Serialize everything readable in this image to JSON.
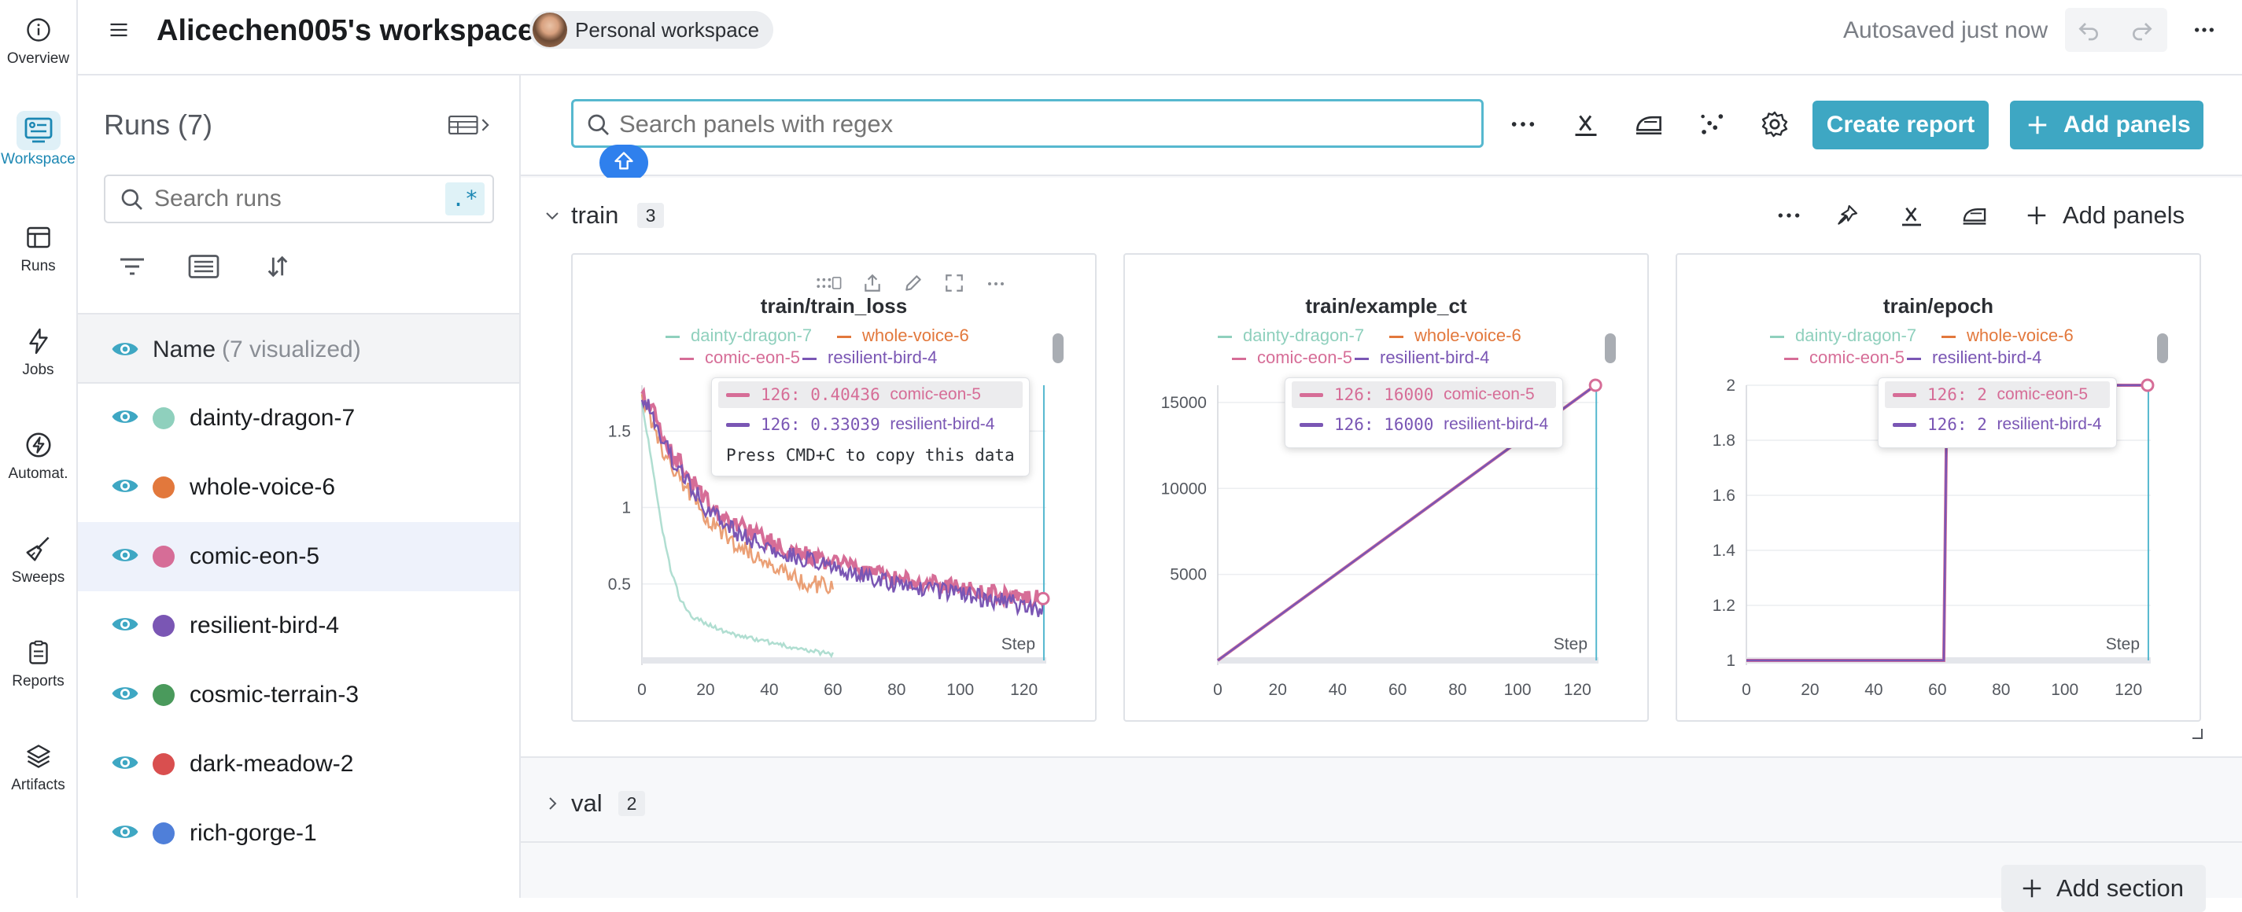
{
  "nav": {
    "items": [
      {
        "label": "Overview",
        "icon": "info-icon"
      },
      {
        "label": "Workspace",
        "icon": "workspace-icon"
      },
      {
        "label": "Runs",
        "icon": "table-icon"
      },
      {
        "label": "Jobs",
        "icon": "lightning-icon"
      },
      {
        "label": "Automat.",
        "icon": "automation-icon"
      },
      {
        "label": "Sweeps",
        "icon": "broom-icon"
      },
      {
        "label": "Reports",
        "icon": "clipboard-icon"
      },
      {
        "label": "Artifacts",
        "icon": "layers-icon"
      }
    ]
  },
  "header": {
    "title": "Alicechen005's workspace",
    "workspace_badge": "Personal workspace",
    "autosave": "Autosaved just now"
  },
  "runs": {
    "title": "Runs (7)",
    "search_placeholder": "Search runs",
    "regex_label": ".*",
    "name_col": "Name",
    "visualized": "(7 visualized)",
    "items": [
      {
        "name": "dainty-dragon-7",
        "color": "#8fd0bd"
      },
      {
        "name": "whole-voice-6",
        "color": "#e2783c"
      },
      {
        "name": "comic-eon-5",
        "color": "#d66d97"
      },
      {
        "name": "resilient-bird-4",
        "color": "#7a56b4"
      },
      {
        "name": "cosmic-terrain-3",
        "color": "#4a9a5c"
      },
      {
        "name": "dark-meadow-2",
        "color": "#d94f4f"
      },
      {
        "name": "rich-gorge-1",
        "color": "#4f7fd9"
      }
    ]
  },
  "toolbar": {
    "search_placeholder": "Search panels with regex",
    "create_report": "Create report",
    "add_panels": "Add panels"
  },
  "sections": {
    "train": {
      "name": "train",
      "count": "3",
      "add_panels": "Add panels"
    },
    "val": {
      "name": "val",
      "count": "2"
    },
    "add_section": "Add section"
  },
  "legend": {
    "dainty": "dainty-dragon-7",
    "whole": "whole-voice-6",
    "comic": "comic-eon-5",
    "resilient": "resilient-bird-4"
  },
  "colors": {
    "dainty": "#8fd0bd",
    "whole": "#e2783c",
    "comic": "#d66d97",
    "resilient": "#7a56b4",
    "accent": "#3ea7c3"
  },
  "panels": [
    {
      "title": "train/train_loss",
      "step_label": "Step",
      "tooltip": {
        "rows": [
          {
            "text": "126:  0.40436",
            "run": "comic-eon-5"
          },
          {
            "text": "126:  0.33039",
            "run": "resilient-bird-4"
          }
        ],
        "hint": "Press CMD+C to copy this data"
      }
    },
    {
      "title": "train/example_ct",
      "step_label": "Step",
      "tooltip": {
        "rows": [
          {
            "text": "126:  16000",
            "run": "comic-eon-5"
          },
          {
            "text": "126:  16000",
            "run": "resilient-bird-4"
          }
        ]
      }
    },
    {
      "title": "train/epoch",
      "step_label": "Step",
      "tooltip": {
        "rows": [
          {
            "text": "126:  2",
            "run": "comic-eon-5"
          },
          {
            "text": "126:  2",
            "run": "resilient-bird-4"
          }
        ]
      }
    }
  ],
  "chart_data": [
    {
      "type": "line",
      "title": "train/train_loss",
      "xlabel": "Step",
      "xlim": [
        0,
        127
      ],
      "ylim": [
        0,
        1.8
      ],
      "xticks": [
        0,
        20,
        40,
        60,
        80,
        100,
        120
      ],
      "yticks": [
        0.5,
        1,
        1.5
      ],
      "series": [
        {
          "name": "dainty-dragon-7",
          "x": [
            0,
            3,
            6,
            9,
            12,
            15,
            20,
            25,
            30,
            40,
            50,
            60
          ],
          "y": [
            1.7,
            1.3,
            0.9,
            0.6,
            0.4,
            0.3,
            0.24,
            0.2,
            0.16,
            0.12,
            0.07,
            0.04
          ]
        },
        {
          "name": "whole-voice-6",
          "x": [
            0,
            5,
            10,
            15,
            20,
            25,
            30,
            35,
            40,
            45,
            50,
            55,
            60
          ],
          "y": [
            1.75,
            1.45,
            1.25,
            1.1,
            0.95,
            0.85,
            0.75,
            0.7,
            0.62,
            0.58,
            0.52,
            0.5,
            0.48
          ]
        },
        {
          "name": "comic-eon-5",
          "x": [
            0,
            5,
            10,
            15,
            20,
            25,
            30,
            40,
            50,
            60,
            70,
            80,
            90,
            100,
            110,
            120,
            126
          ],
          "y": [
            1.78,
            1.55,
            1.35,
            1.2,
            1.05,
            0.95,
            0.88,
            0.78,
            0.7,
            0.64,
            0.58,
            0.54,
            0.5,
            0.47,
            0.44,
            0.42,
            0.40436
          ]
        },
        {
          "name": "resilient-bird-4",
          "x": [
            0,
            5,
            10,
            15,
            20,
            25,
            30,
            40,
            50,
            60,
            70,
            80,
            90,
            100,
            110,
            120,
            126
          ],
          "y": [
            1.75,
            1.5,
            1.3,
            1.15,
            1.0,
            0.9,
            0.83,
            0.74,
            0.67,
            0.61,
            0.55,
            0.5,
            0.46,
            0.43,
            0.4,
            0.36,
            0.33039
          ]
        }
      ]
    },
    {
      "type": "line",
      "title": "train/example_ct",
      "xlabel": "Step",
      "xlim": [
        0,
        127
      ],
      "ylim": [
        0,
        16000
      ],
      "xticks": [
        0,
        20,
        40,
        60,
        80,
        100,
        120
      ],
      "yticks": [
        5000,
        10000,
        15000
      ],
      "series": [
        {
          "name": "comic-eon-5",
          "x": [
            0,
            126
          ],
          "y": [
            0,
            16000
          ]
        },
        {
          "name": "resilient-bird-4",
          "x": [
            0,
            126
          ],
          "y": [
            0,
            16000
          ]
        }
      ]
    },
    {
      "type": "line",
      "title": "train/epoch",
      "xlabel": "Step",
      "xlim": [
        0,
        127
      ],
      "ylim": [
        1,
        2
      ],
      "xticks": [
        0,
        20,
        40,
        60,
        80,
        100,
        120
      ],
      "yticks": [
        1,
        1.2,
        1.4,
        1.6,
        1.8,
        2
      ],
      "series": [
        {
          "name": "comic-eon-5",
          "x": [
            0,
            62,
            63,
            126
          ],
          "y": [
            1,
            1,
            2,
            2
          ]
        },
        {
          "name": "resilient-bird-4",
          "x": [
            0,
            62,
            63,
            126
          ],
          "y": [
            1,
            1,
            2,
            2
          ]
        }
      ]
    }
  ]
}
